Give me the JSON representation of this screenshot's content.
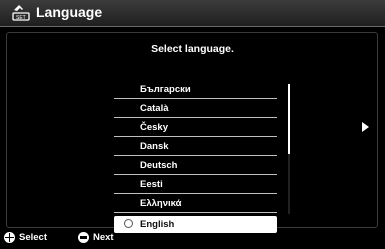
{
  "header": {
    "title": "Language",
    "icon": "toolbox-settings-icon"
  },
  "prompt": "Select language.",
  "languages": [
    {
      "label": "Български"
    },
    {
      "label": "Català"
    },
    {
      "label": "Česky"
    },
    {
      "label": "Dansk"
    },
    {
      "label": "Deutsch"
    },
    {
      "label": "Eesti"
    },
    {
      "label": "Ελληνικά"
    },
    {
      "label": "English",
      "selected": true
    }
  ],
  "footer": {
    "select_label": "Select",
    "next_label": "Next"
  },
  "colors": {
    "background": "#000000",
    "text": "#ffffff",
    "selected_bg": "#ffffff"
  }
}
